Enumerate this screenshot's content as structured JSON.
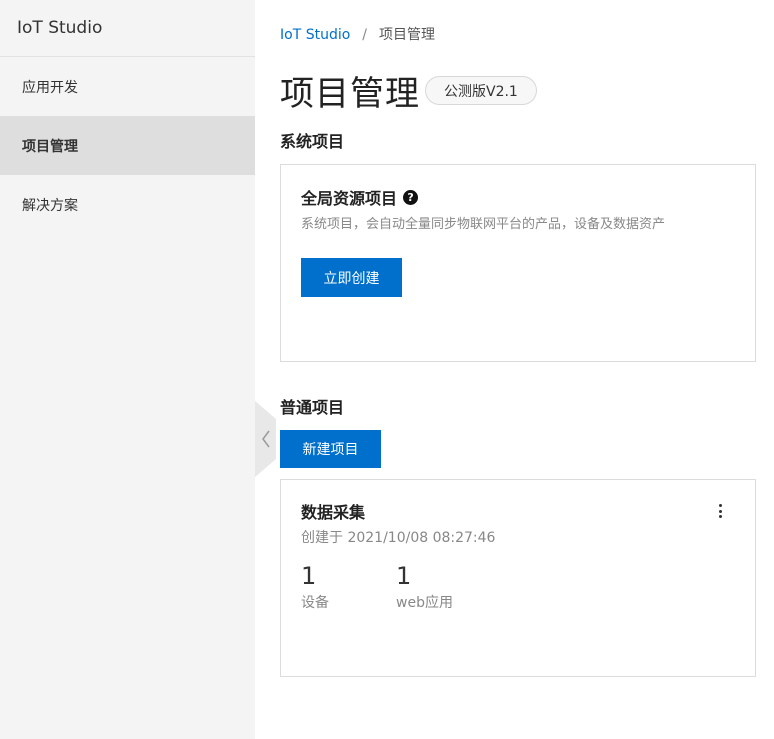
{
  "sidebar": {
    "app_title": "IoT Studio",
    "items": [
      {
        "label": "应用开发",
        "active": false
      },
      {
        "label": "项目管理",
        "active": true
      },
      {
        "label": "解决方案",
        "active": false
      }
    ]
  },
  "breadcrumb": {
    "root": "IoT Studio",
    "separator": "/",
    "current": "项目管理"
  },
  "page": {
    "title": "项目管理",
    "version_badge": "公测版V2.1"
  },
  "system_section": {
    "heading": "系统项目",
    "card": {
      "title": "全局资源项目",
      "help_glyph": "?",
      "description": "系统项目，会自动全量同步物联网平台的产品，设备及数据资产",
      "create_button": "立即创建"
    }
  },
  "normal_section": {
    "heading": "普通项目",
    "new_button": "新建项目",
    "projects": [
      {
        "name": "数据采集",
        "created": "创建于 2021/10/08 08:27:46",
        "stats": [
          {
            "value": "1",
            "label": "设备"
          },
          {
            "value": "1",
            "label": "web应用"
          }
        ]
      }
    ]
  },
  "colors": {
    "primary": "#0070cc",
    "sidebar_bg": "#f4f4f4",
    "sidebar_active": "#dedede"
  },
  "icons": {
    "collapse": "chevron-left-icon",
    "help": "question-circle-icon",
    "more": "more-vertical-icon"
  }
}
